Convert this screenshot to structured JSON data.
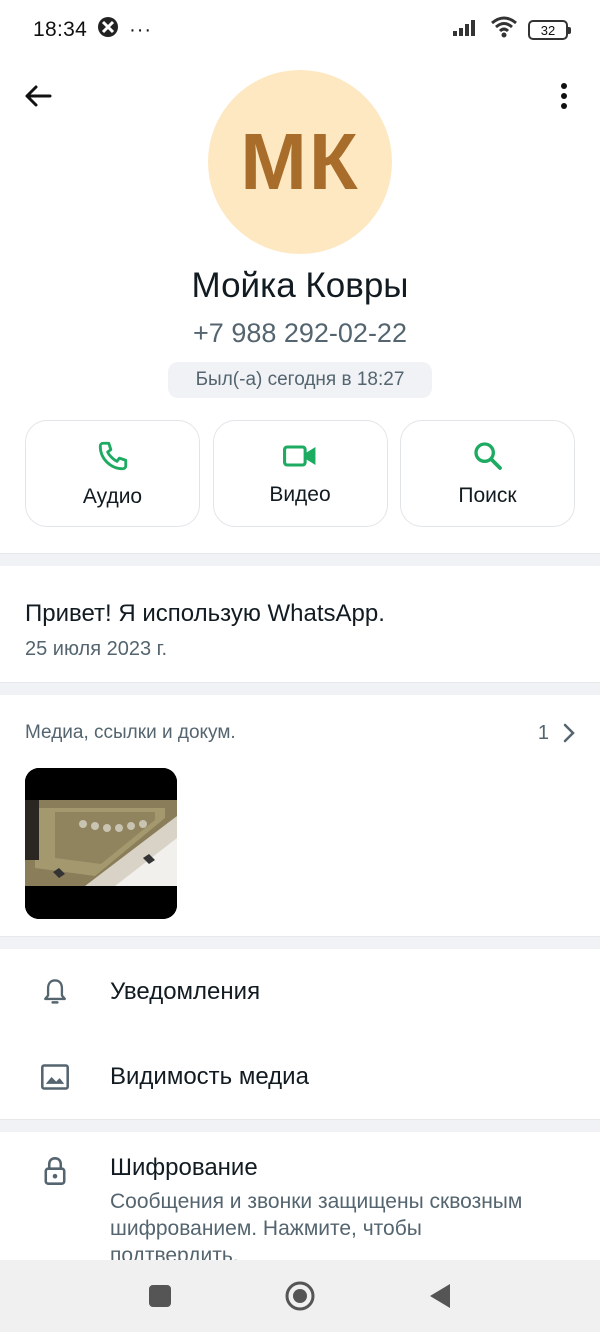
{
  "status_bar": {
    "time": "18:34",
    "dots": "···",
    "battery": "32"
  },
  "contact": {
    "initials": "МК",
    "name": "Мойка Ковры",
    "phone": "+7 988 292-02-22",
    "last_seen": "Был(-а) сегодня в 18:27"
  },
  "actions": [
    {
      "label": "Аудио",
      "icon": "phone-icon"
    },
    {
      "label": "Видео",
      "icon": "video-icon"
    },
    {
      "label": "Поиск",
      "icon": "search-icon"
    }
  ],
  "about": {
    "text": "Привет! Я использую WhatsApp.",
    "date": "25 июля 2023 г."
  },
  "media": {
    "title": "Медиа, ссылки и докум.",
    "count": "1"
  },
  "settings": {
    "notifications": "Уведомления",
    "media_visibility": "Видимость медиа",
    "encryption_title": "Шифрование",
    "encryption_desc": "Сообщения и звонки защищены сквозным шифрованием. Нажмите, чтобы подтвердить."
  },
  "colors": {
    "accent": "#1daa61",
    "avatar_bg": "#fde8c2",
    "avatar_text": "#a86d2a"
  }
}
